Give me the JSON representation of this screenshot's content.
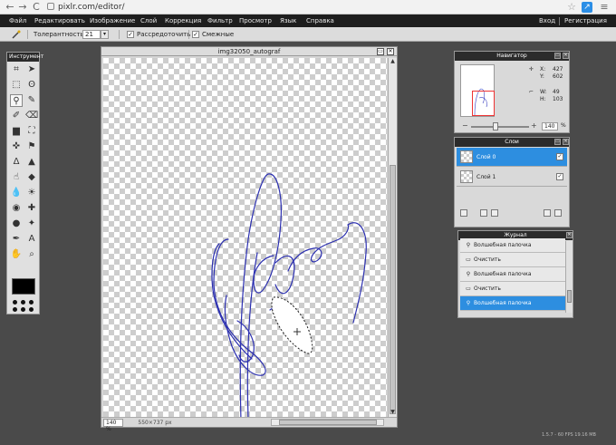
{
  "browser": {
    "url": "pixlr.com/editor/",
    "back": "←",
    "forward": "→",
    "reload": "C",
    "star": "☆",
    "ext": "↗",
    "menu": "≡"
  },
  "menubar": {
    "items": [
      "Файл",
      "Редактировать",
      "Изображение",
      "Слой",
      "Коррекция",
      "Фильтр",
      "Просмотр",
      "Язык",
      "Справка"
    ],
    "login": "Вход",
    "register": "Регистрация"
  },
  "options": {
    "tolerance_label": "Толерантность:",
    "tolerance_value": "21",
    "antialias_label": "Рассредоточить",
    "contiguous_label": "Смежные",
    "antialias_checked": "✓",
    "contiguous_checked": "✓"
  },
  "tools": {
    "title": "Инструмент",
    "items": [
      {
        "icon": "crop-icon",
        "glyph": "⌗"
      },
      {
        "icon": "move-icon",
        "glyph": "➤"
      },
      {
        "icon": "marquee-icon",
        "glyph": "⬚"
      },
      {
        "icon": "lasso-icon",
        "glyph": "ʘ"
      },
      {
        "icon": "magic-wand-icon",
        "glyph": "⚲"
      },
      {
        "icon": "pencil-icon",
        "glyph": "✎"
      },
      {
        "icon": "brush-icon",
        "glyph": "✐"
      },
      {
        "icon": "eraser-icon",
        "glyph": "⌫"
      },
      {
        "icon": "gradient-icon",
        "glyph": "▆"
      },
      {
        "icon": "bucket-icon",
        "glyph": "⛶"
      },
      {
        "icon": "replace-color-icon",
        "glyph": "✜"
      },
      {
        "icon": "stamp-icon",
        "glyph": "⚑"
      },
      {
        "icon": "blur-icon",
        "glyph": "Δ"
      },
      {
        "icon": "sharpen-icon",
        "glyph": "▲"
      },
      {
        "icon": "smudge-icon",
        "glyph": "☝"
      },
      {
        "icon": "sponge-icon",
        "glyph": "◆"
      },
      {
        "icon": "drop-icon",
        "glyph": "💧"
      },
      {
        "icon": "burn-icon",
        "glyph": "☀"
      },
      {
        "icon": "redeye-icon",
        "glyph": "◉"
      },
      {
        "icon": "spot-heal-icon",
        "glyph": "✚"
      },
      {
        "icon": "bloat-icon",
        "glyph": "●"
      },
      {
        "icon": "pinch-icon",
        "glyph": "✦"
      },
      {
        "icon": "picker-icon",
        "glyph": "✒"
      },
      {
        "icon": "text-icon",
        "glyph": "A"
      },
      {
        "icon": "hand-icon",
        "glyph": "✋"
      },
      {
        "icon": "zoom-icon",
        "glyph": "⌕"
      }
    ]
  },
  "document": {
    "title": "img32050_autograf",
    "zoom": "140 %",
    "size": "550×737 px"
  },
  "navigator": {
    "title": "Навигатор",
    "x_label": "X:",
    "x": "427",
    "y_label": "Y:",
    "y": "602",
    "w_label": "W:",
    "w": "49",
    "h_label": "H:",
    "h": "103",
    "zoom": "140",
    "zoom_unit": "%"
  },
  "layers": {
    "title": "Слои",
    "items": [
      {
        "name": "Слой 0",
        "checked": "✓"
      },
      {
        "name": "Слой 1",
        "checked": "✓"
      }
    ]
  },
  "history": {
    "title": "Журнал",
    "items": [
      {
        "label": "Волшебная палочка",
        "icon": "⚲"
      },
      {
        "label": "Очистить",
        "icon": "▭"
      },
      {
        "label": "Волшебная палочка",
        "icon": "⚲"
      },
      {
        "label": "Очистить",
        "icon": "▭"
      },
      {
        "label": "Волшебная палочка",
        "icon": "⚲"
      }
    ]
  },
  "footer": {
    "fps": "1.5.7 - 60 FPS 19.16 MB"
  },
  "colors": {
    "menubar": "#1e1e1e",
    "selection": "#2d8ee0",
    "signature": "#2b2fb0"
  }
}
